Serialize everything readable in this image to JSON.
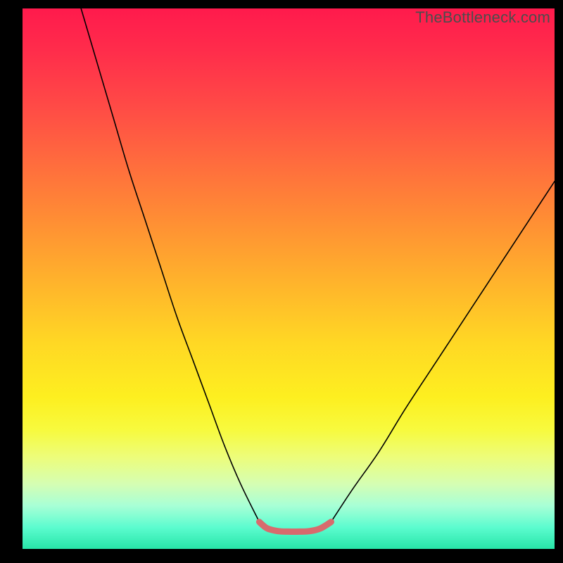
{
  "watermark": "TheBottleneck.com",
  "colors": {
    "curve_stroke": "#000000",
    "flat_stroke": "#d86b6d"
  },
  "chart_data": {
    "type": "line",
    "title": "",
    "xlabel": "",
    "ylabel": "",
    "xlim": [
      0,
      100
    ],
    "ylim": [
      0,
      100
    ],
    "series": [
      {
        "name": "left-curve",
        "x": [
          11,
          14,
          17,
          20,
          23,
          26,
          29,
          32,
          35,
          38,
          41,
          44.5
        ],
        "y": [
          100,
          90,
          80,
          70,
          61,
          52,
          43,
          35,
          27,
          19,
          12,
          5
        ]
      },
      {
        "name": "plateau",
        "x": [
          44.5,
          46,
          48,
          50,
          52,
          54,
          56,
          58
        ],
        "y": [
          5,
          3.8,
          3.3,
          3.2,
          3.2,
          3.3,
          3.8,
          5
        ]
      },
      {
        "name": "right-curve",
        "x": [
          58,
          62,
          67,
          72,
          78,
          84,
          90,
          96,
          100
        ],
        "y": [
          5,
          11,
          18,
          26,
          35,
          44,
          53,
          62,
          68
        ]
      }
    ],
    "plateau_style": {
      "stroke": "#d86b6d",
      "linewidth": 9,
      "linecap": "round"
    },
    "curve_style": {
      "stroke": "#000000",
      "linewidth": 1.6
    }
  }
}
